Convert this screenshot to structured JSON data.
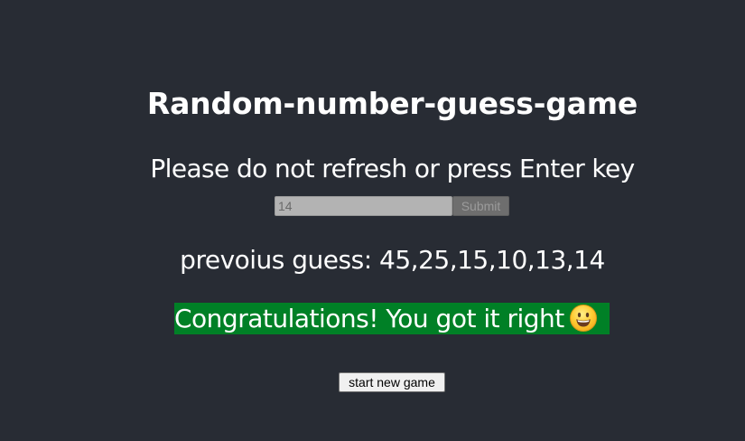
{
  "app": {
    "title": "Random-number-guess-game",
    "instruction": "Please do not refresh or press Enter key"
  },
  "guess_form": {
    "input_value": "14",
    "submit_label": "Submit",
    "submit_disabled": true
  },
  "history": {
    "text": "prevoius guess: 45,25,15,10,13,14"
  },
  "result": {
    "message": "Congratulations! You got it right",
    "icon": "smile-icon",
    "background_color": "#008026"
  },
  "actions": {
    "new_game_label": "start new game"
  },
  "theme": {
    "page_background": "#282c34",
    "text_color": "#ffffff"
  }
}
